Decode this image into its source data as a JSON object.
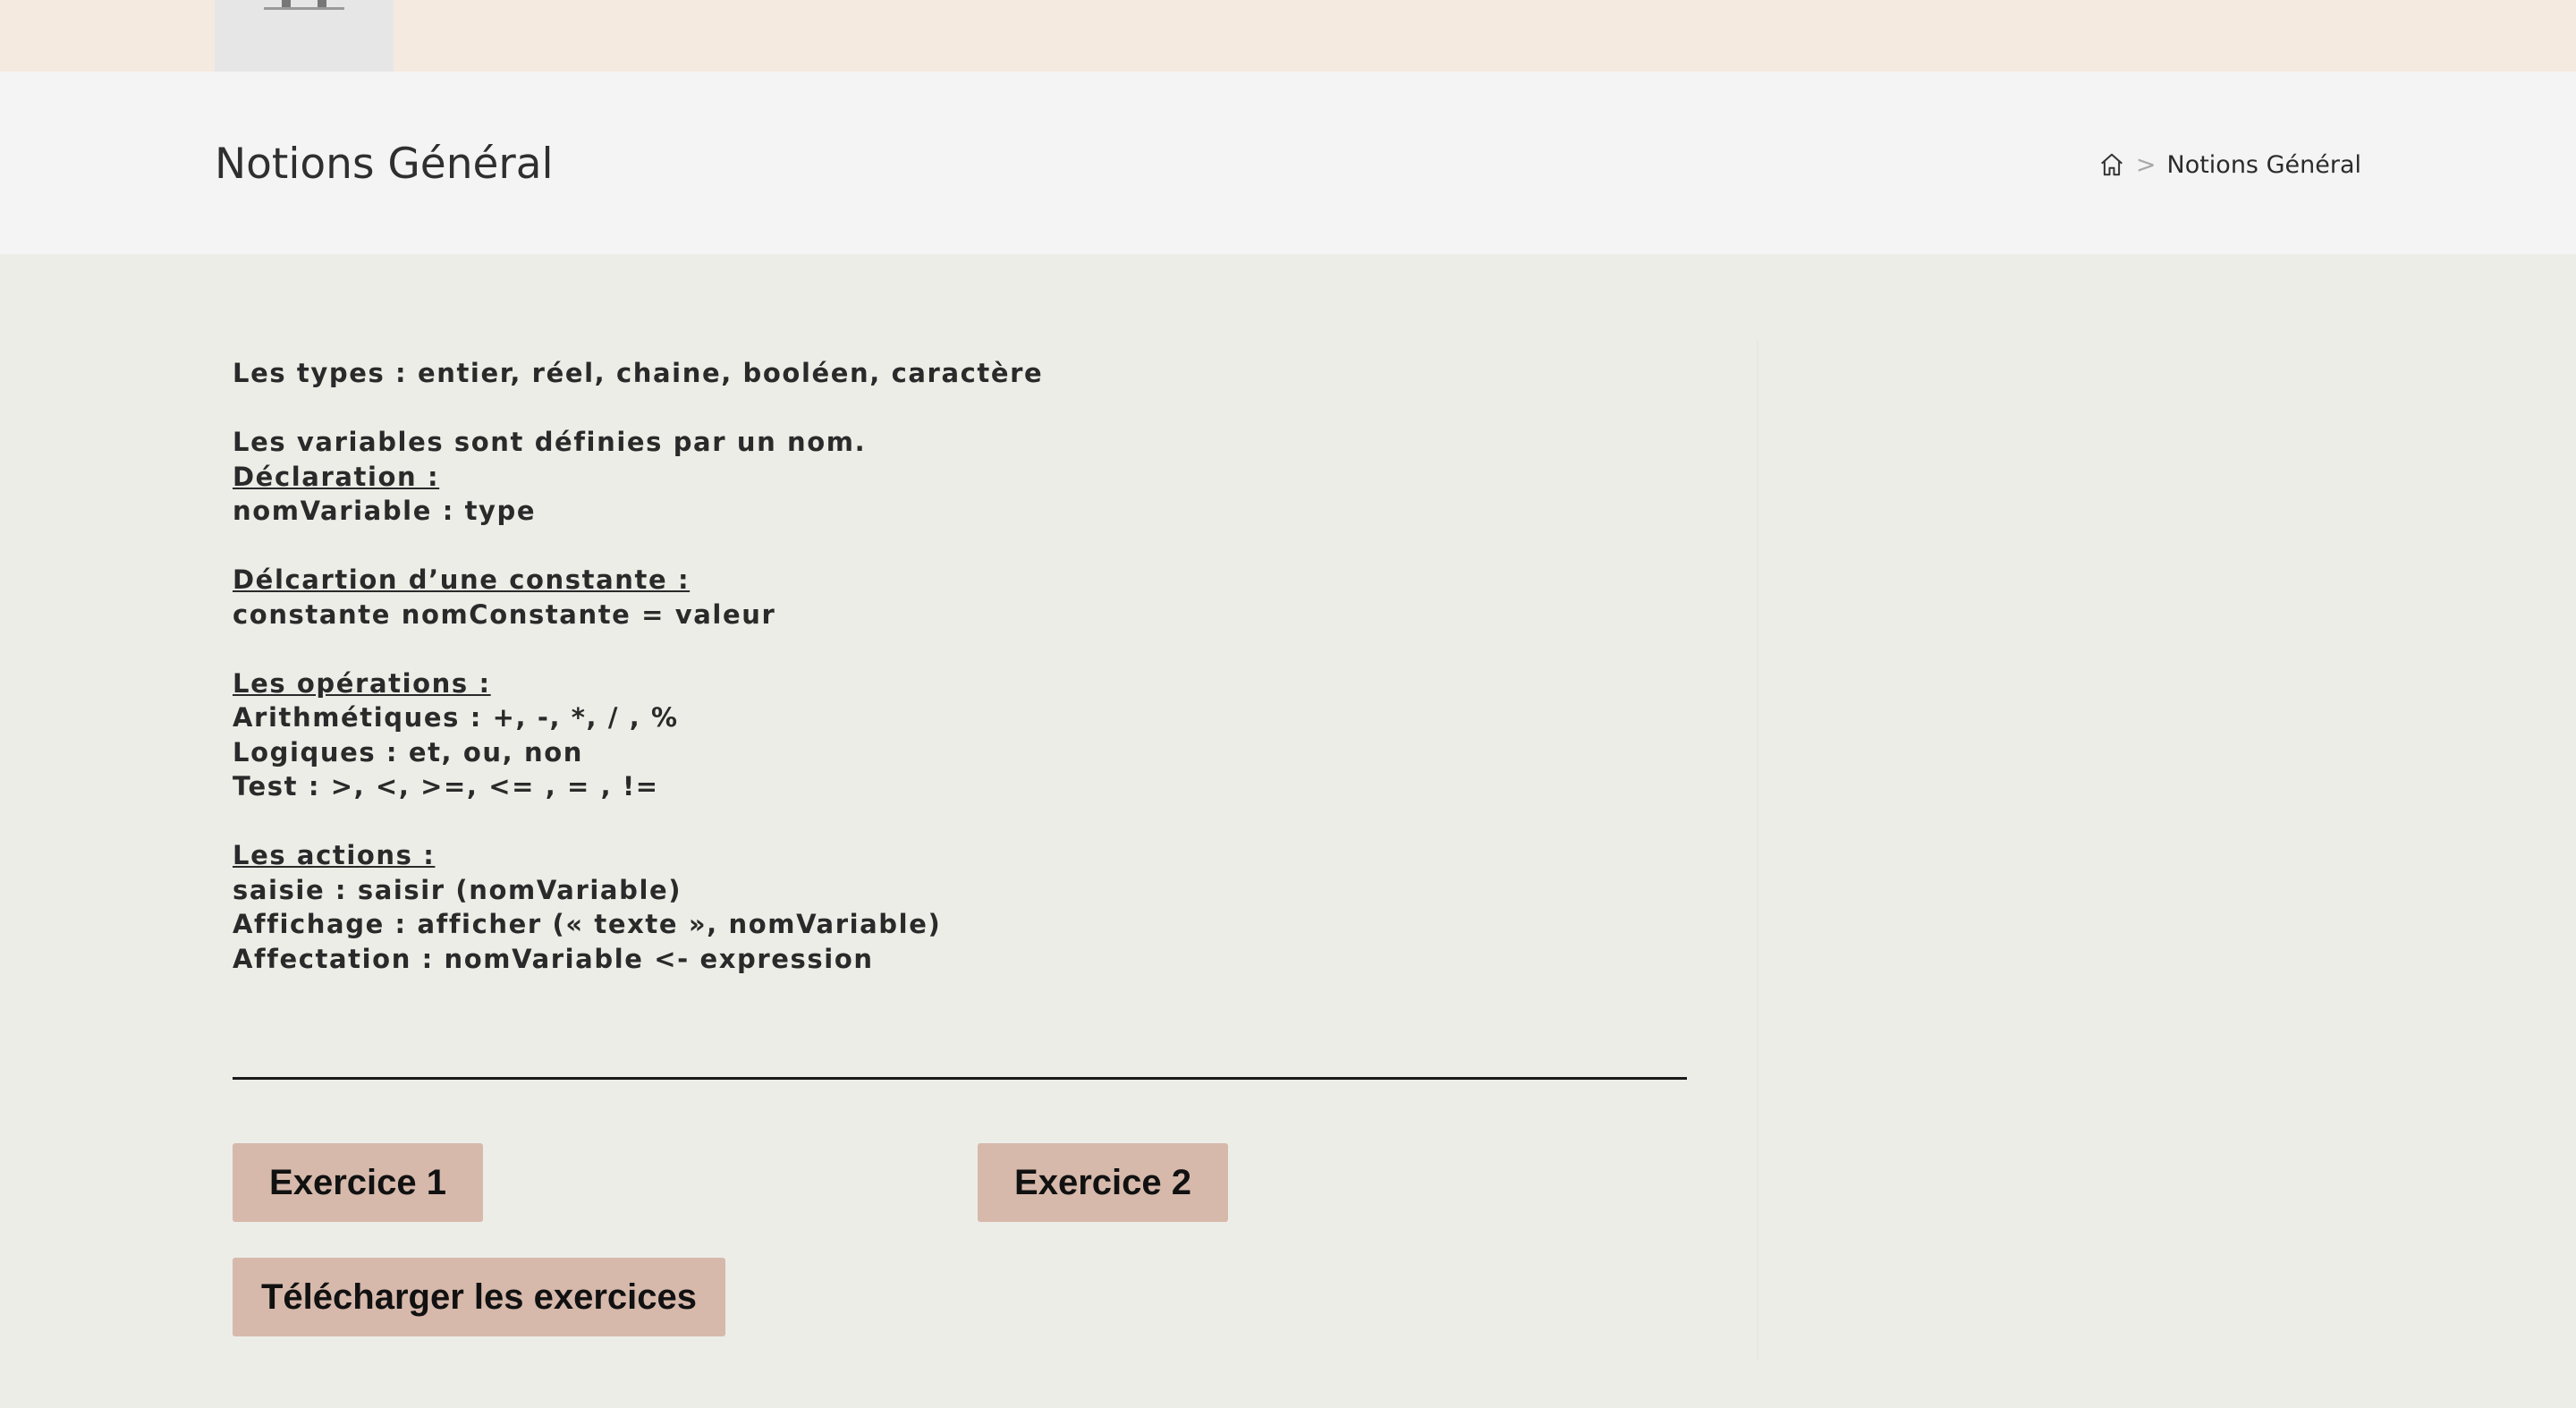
{
  "header": {
    "title": "Notions Général",
    "breadcrumb": {
      "home_icon": "home-icon",
      "separator": ">",
      "current": "Notions Général"
    }
  },
  "content": {
    "types": "Les types : entier, réel, chaine, booléen, caractère",
    "variables_intro": "Les variables sont définies par un nom.",
    "declaration_heading": "Déclaration :",
    "declaration_syntax": "nomVariable : type",
    "constant_heading": "Délcartion d’une constante :",
    "constant_syntax": "constante nomConstante = valeur",
    "operations_heading": "Les opérations :",
    "op_arith": "Arithmétiques : +, -, *, / , %",
    "op_logic": "Logiques : et, ou, non",
    "op_test": "Test : >, <, >=, <= , = , !=",
    "actions_heading": "Les actions :",
    "action_input": "saisie : saisir (nomVariable)",
    "action_output": "Affichage : afficher (« texte », nomVariable)",
    "action_assign": "Affectation : nomVariable <- expression"
  },
  "buttons": {
    "exercise1": "Exercice 1",
    "exercise2": "Exercice 2",
    "download": "Télécharger les exercices"
  },
  "colors": {
    "topbar": "#f5eae0",
    "header_band": "#f4f4f4",
    "page_bg": "#edede8",
    "button_bg": "#d6b9ab"
  }
}
